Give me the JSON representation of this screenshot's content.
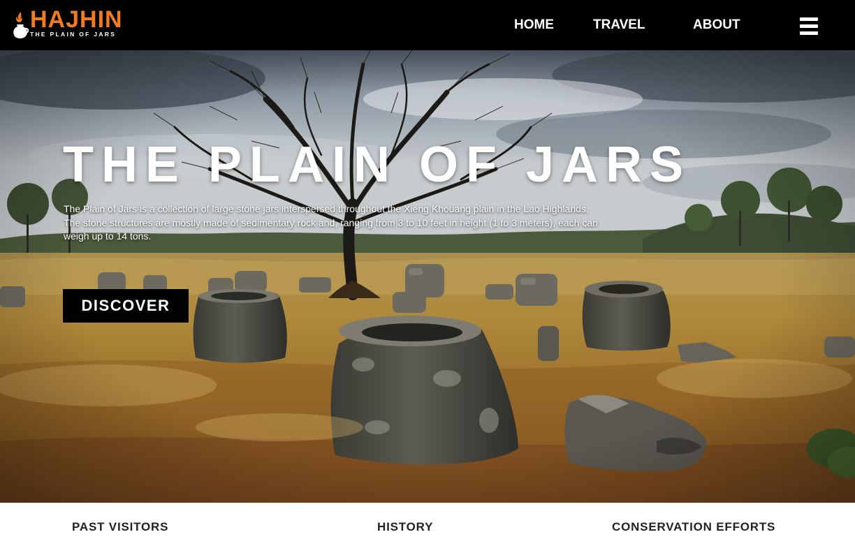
{
  "brand": {
    "name": "HAJHIN",
    "tagline": "THE PLAIN OF JARS",
    "accent_color": "#f47a20",
    "logo_icon": "jar-flame-icon"
  },
  "nav": {
    "items": [
      {
        "label": "HOME"
      },
      {
        "label": "TRAVEL"
      },
      {
        "label": "ABOUT"
      }
    ],
    "menu_icon": "hamburger-menu-icon"
  },
  "hero": {
    "title": "THE PLAIN OF JARS",
    "description_lines": [
      "The Plain of Jars is a collection of large stone jars interspersed throughout the Xieng Khouang plain in the Lao Highlands.",
      "The stone structures are mostly made of sedimentary rock and, ranging from 3 to 10 feet in height (1 to 3 meters), each can",
      "weigh up to 14 tons."
    ],
    "cta_label": "DISCOVER"
  },
  "footer_nav": {
    "items": [
      {
        "label": "PAST VISITORS"
      },
      {
        "label": "HISTORY"
      },
      {
        "label": "CONSERVATION EFFORTS"
      }
    ]
  }
}
